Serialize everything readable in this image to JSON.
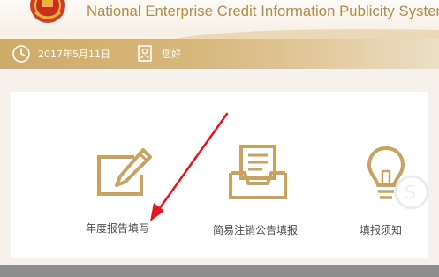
{
  "header": {
    "site_title": "National Enterprise Credit Information Publicity System",
    "emblem_icon": "national-emblem-icon"
  },
  "toolbar": {
    "date": "2017年5月11日",
    "date_icon": "clock-icon",
    "greeting": "您好",
    "greeting_icon": "user-badge-icon"
  },
  "tiles": [
    {
      "label": "年度报告填写",
      "icon": "pencil-edit-icon"
    },
    {
      "label": "简易注销公告填报",
      "icon": "document-tray-icon"
    },
    {
      "label": "填报须知",
      "icon": "lightbulb-icon"
    }
  ],
  "annotation": {
    "arrow_color": "#e8141b",
    "points_to": "年度报告填写"
  },
  "colors": {
    "accent_gold": "#c9a262",
    "title_gold": "#b8893f",
    "toolbar_gold": "#d4b274",
    "footer_gray": "#8d8d8d"
  }
}
